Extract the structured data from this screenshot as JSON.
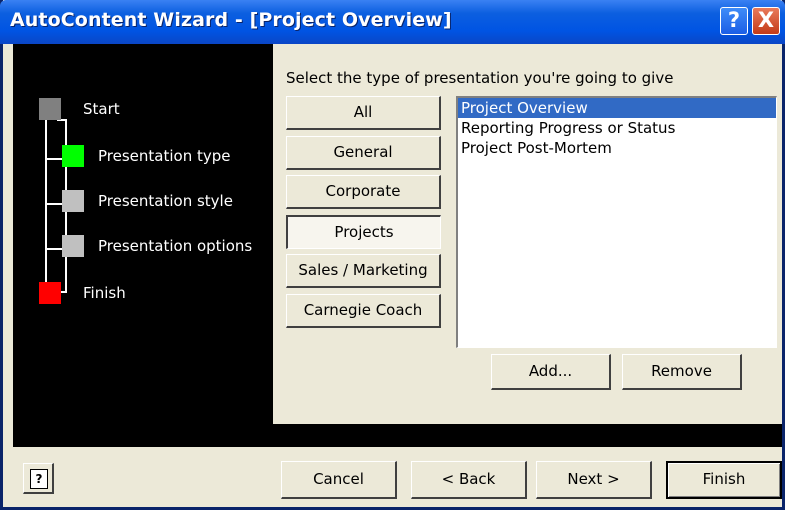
{
  "window": {
    "title": "AutoContent Wizard - [Project Overview]",
    "help_icon": "?",
    "close_icon": "X"
  },
  "steps": [
    {
      "label": "Start",
      "state": "completed",
      "color": "#808080"
    },
    {
      "label": "Presentation type",
      "state": "current",
      "color": "#00ff00"
    },
    {
      "label": "Presentation style",
      "state": "pending",
      "color": "#c0c0c0"
    },
    {
      "label": "Presentation options",
      "state": "pending",
      "color": "#c0c0c0"
    },
    {
      "label": "Finish",
      "state": "end",
      "color": "#ff0000"
    }
  ],
  "main": {
    "prompt": "Select the type of presentation you're going to give",
    "categories": [
      {
        "label": "All",
        "active": false
      },
      {
        "label": "General",
        "active": false
      },
      {
        "label": "Corporate",
        "active": false
      },
      {
        "label": "Projects",
        "active": true
      },
      {
        "label": "Sales / Marketing",
        "active": false
      },
      {
        "label": "Carnegie Coach",
        "active": false
      }
    ],
    "list_items": [
      {
        "label": "Project Overview",
        "selected": true
      },
      {
        "label": "Reporting Progress or Status",
        "selected": false
      },
      {
        "label": "Project Post-Mortem",
        "selected": false
      }
    ],
    "add_label": "Add...",
    "remove_label": "Remove"
  },
  "footer": {
    "help_glyph": "?",
    "cancel_label": "Cancel",
    "back_label": "< Back",
    "next_label": "Next >",
    "finish_label": "Finish"
  },
  "colors": {
    "titlebar": "#0054e3",
    "selection": "#316ac5",
    "dialog_bg": "#ece9d8",
    "panel_bg": "#000000"
  }
}
